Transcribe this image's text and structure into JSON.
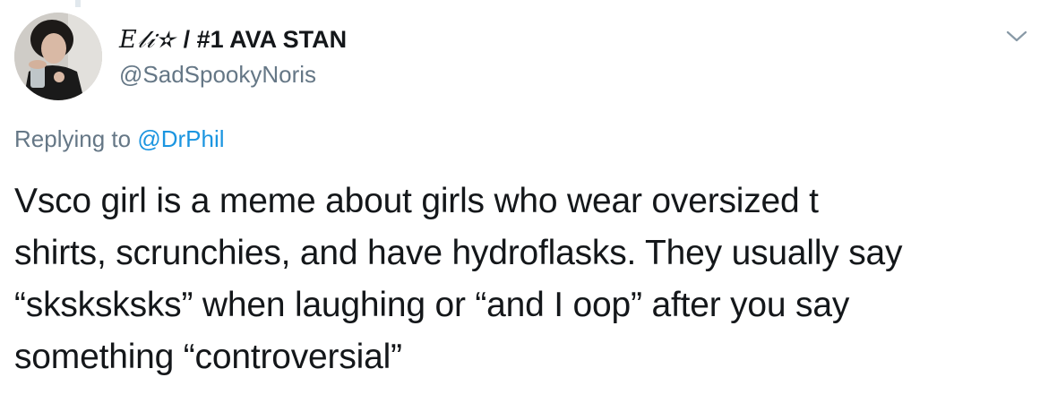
{
  "author": {
    "display_name_fancy": "𝐸𝓁𝒾✫",
    "display_name_rest": " / #1 AVA STAN",
    "handle": "@SadSpookyNoris"
  },
  "reply": {
    "prefix": "Replying to ",
    "mention": "@DrPhil"
  },
  "tweet": {
    "text": "Vsco girl is a meme about girls who wear oversized t\nshirts, scrunchies, and have hydroflasks. They usually say\n“sksksksks” when laughing or “and I oop” after you say\nsomething “controversial”"
  },
  "icons": {
    "menu": "chevron-down-icon"
  },
  "colors": {
    "text": "#14171a",
    "muted": "#657786",
    "link": "#1b95e0"
  }
}
